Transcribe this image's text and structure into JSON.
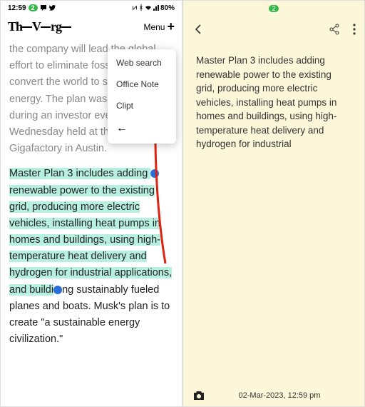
{
  "left": {
    "status": {
      "time": "12:59",
      "badge": "2",
      "battery": "80%"
    },
    "logo": "TheVerge",
    "menu_label": "Menu",
    "popup": {
      "i0": "Web search",
      "i1": "Office Note",
      "i2": "Clipt"
    },
    "p1": "the company will lead the global effort to eliminate fossil fuels and convert the world to sustainable energy. The plan was unveiled during an investor event on Wednesday held at the company's Gigafactory in Austin.",
    "p2a": "Master Plan 3 includes adding ",
    "p2b": "renewable power to the existing ",
    "p2c": "grid, producing more electric vehicles, installing heat pumps in homes and buildings, using high-",
    "p2d": "temperature heat delivery and hydrogen for industrial applications, and buildi",
    "p2e": "ng sustainably fueled planes and boats. Musk's plan is to create \"a sustainable energy civilization.\""
  },
  "right": {
    "status": {
      "badge": "2"
    },
    "note": "Master Plan 3 includes adding renewable power to the existing grid, producing more electric vehicles, installing heat pumps in homes and buildings, using high-temperature heat delivery and hydrogen for industrial",
    "timestamp": "02-Mar-2023, 12:59 pm"
  }
}
